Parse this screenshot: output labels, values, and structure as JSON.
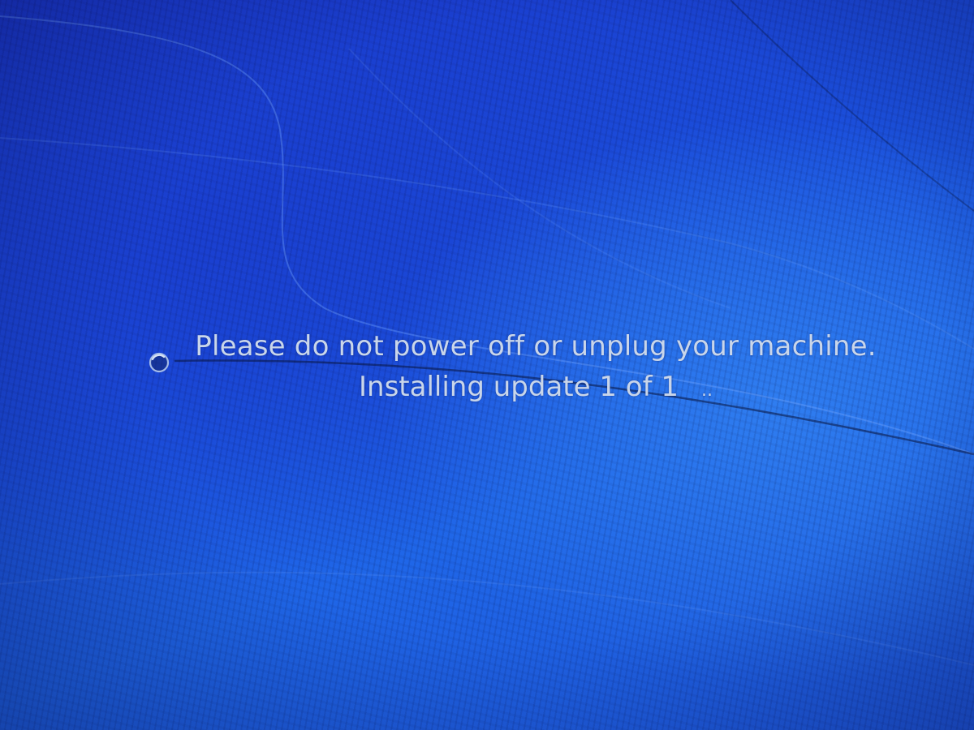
{
  "screen": {
    "background_color": "#1d4fdc",
    "text_color": "#c9d6ea"
  },
  "status": {
    "warning_message": "Please do not power off or unplug your machine.",
    "progress_message": "Installing update 1 of 1",
    "progress_dots": ".."
  },
  "icons": {
    "spinner": "busy-spinner-icon"
  }
}
